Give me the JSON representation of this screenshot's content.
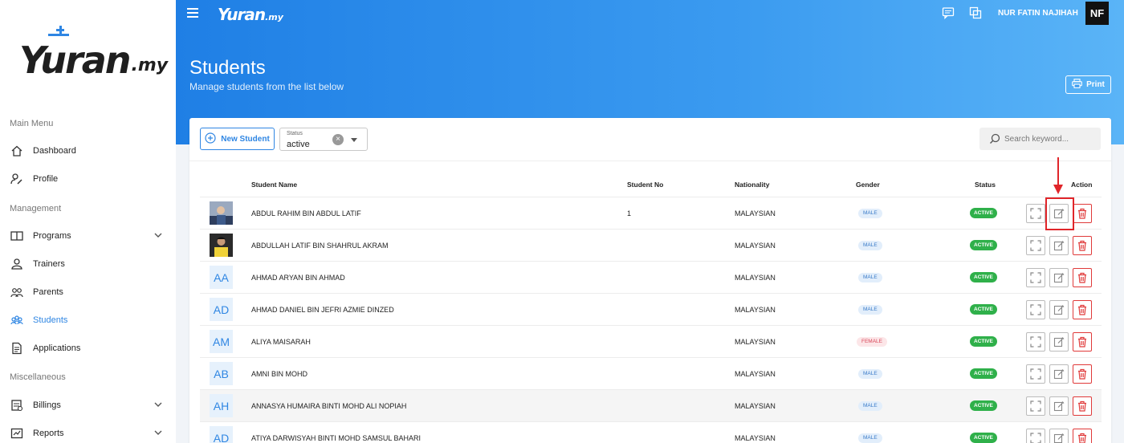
{
  "brand": {
    "logo_main": "Yuran",
    "logo_sub": ".my",
    "header_logo_main": "Yuran",
    "header_logo_sub": ".my"
  },
  "sidebar": {
    "sections": [
      {
        "label": "Main Menu"
      },
      {
        "label": "Management"
      },
      {
        "label": "Miscellaneous"
      }
    ],
    "items": [
      {
        "label": "Dashboard",
        "icon": "home-icon"
      },
      {
        "label": "Profile",
        "icon": "user-edit-icon"
      },
      {
        "label": "Programs",
        "icon": "book-icon",
        "expandable": true
      },
      {
        "label": "Trainers",
        "icon": "trainer-icon"
      },
      {
        "label": "Parents",
        "icon": "parents-icon"
      },
      {
        "label": "Students",
        "icon": "students-icon",
        "active": true
      },
      {
        "label": "Applications",
        "icon": "document-icon"
      },
      {
        "label": "Billings",
        "icon": "billing-icon",
        "expandable": true
      },
      {
        "label": "Reports",
        "icon": "report-icon",
        "expandable": true
      }
    ]
  },
  "header": {
    "user_name": "NUR FATIN NAJIHAH",
    "user_initials": "NF",
    "title": "Students",
    "subtitle": "Manage students from the list below",
    "print_label": "Print"
  },
  "toolbar": {
    "new_label": "New Student",
    "status_label": "Status",
    "status_value": "active",
    "search_placeholder": "Search keyword..."
  },
  "table": {
    "headers": {
      "name": "Student Name",
      "no": "Student No",
      "nationality": "Nationality",
      "gender": "Gender",
      "status": "Status",
      "action": "Action"
    },
    "rows": [
      {
        "avatar": "photo",
        "initials": "",
        "name": "ABDUL RAHIM BIN ABDUL LATIF",
        "no": "1",
        "nationality": "MALAYSIAN",
        "gender": "MALE",
        "status": "ACTIVE"
      },
      {
        "avatar": "photo",
        "initials": "",
        "name": "ABDULLAH LATIF BIN SHAHRUL AKRAM",
        "no": "",
        "nationality": "MALAYSIAN",
        "gender": "MALE",
        "status": "ACTIVE"
      },
      {
        "avatar": "initials",
        "initials": "AA",
        "name": "AHMAD ARYAN BIN AHMAD",
        "no": "",
        "nationality": "MALAYSIAN",
        "gender": "MALE",
        "status": "ACTIVE"
      },
      {
        "avatar": "initials",
        "initials": "AD",
        "name": "AHMAD DANIEL BIN JEFRI AZMIE DINZED",
        "no": "",
        "nationality": "MALAYSIAN",
        "gender": "MALE",
        "status": "ACTIVE"
      },
      {
        "avatar": "initials",
        "initials": "AM",
        "name": "ALIYA MAISARAH",
        "no": "",
        "nationality": "MALAYSIAN",
        "gender": "FEMALE",
        "status": "ACTIVE"
      },
      {
        "avatar": "initials",
        "initials": "AB",
        "name": "AMNI BIN MOHD",
        "no": "",
        "nationality": "MALAYSIAN",
        "gender": "MALE",
        "status": "ACTIVE"
      },
      {
        "avatar": "initials",
        "initials": "AH",
        "name": "ANNASYA HUMAIRA BINTI MOHD ALI NOPIAH",
        "no": "",
        "nationality": "MALAYSIAN",
        "gender": "MALE",
        "status": "ACTIVE"
      },
      {
        "avatar": "initials",
        "initials": "AD",
        "name": "ATIYA DARWISYAH BINTI MOHD SAMSUL BAHARI",
        "no": "",
        "nationality": "MALAYSIAN",
        "gender": "MALE",
        "status": "ACTIVE"
      }
    ]
  },
  "colors": {
    "primary": "#2f86e3",
    "active_badge": "#2fb04a",
    "danger": "#e03a3a",
    "highlight": "#e0252a"
  }
}
